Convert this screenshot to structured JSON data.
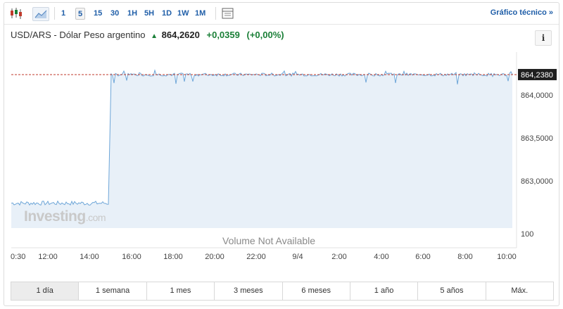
{
  "toolbar": {
    "icons": [
      "candlestick-icon",
      "area-chart-icon",
      "indicators-icon"
    ],
    "intervals": [
      "1",
      "5",
      "15",
      "30",
      "1H",
      "5H",
      "1D",
      "1W",
      "1M"
    ],
    "active_interval": "5",
    "technical_link": "Gráfico técnico »"
  },
  "header": {
    "pair": "USD/ARS - Dólar Peso argentino",
    "direction_icon": "arrow-up-icon",
    "price": "864,2620",
    "change": "+0,0359",
    "change_pct": "(+0,00%)",
    "info_label": "i"
  },
  "watermark": {
    "brand": "Investing",
    "suffix": ".com"
  },
  "volume_text": "Volume Not Available",
  "colors": {
    "line": "#6ea6d8",
    "area": "#e8f0f8",
    "ref_line": "#c0392b",
    "up": "#1a7f37",
    "link": "#1f5ea8"
  },
  "chart_data": {
    "type": "area",
    "y_axis": {
      "ticks": [
        "864,0000",
        "863,5000",
        "863,0000"
      ],
      "tick_values": [
        864.0,
        863.5,
        863.0
      ],
      "current_label": "864,2380",
      "current_value": 864.238,
      "volume_label": "100",
      "ylim": [
        862.45,
        864.5
      ]
    },
    "x_axis": {
      "ticks": [
        "0:30",
        "12:00",
        "14:00",
        "16:00",
        "18:00",
        "20:00",
        "22:00",
        "9/4",
        "2:00",
        "4:00",
        "6:00",
        "8:00",
        "10:00"
      ]
    },
    "series": [
      {
        "values_before_step": 862.74,
        "values_after_step": 864.238,
        "step_at": "15:00"
      }
    ],
    "grid": false
  },
  "periods": [
    "1 día",
    "1 semana",
    "1 mes",
    "3 meses",
    "6 meses",
    "1 año",
    "5 años",
    "Máx."
  ],
  "active_period": "1 día"
}
